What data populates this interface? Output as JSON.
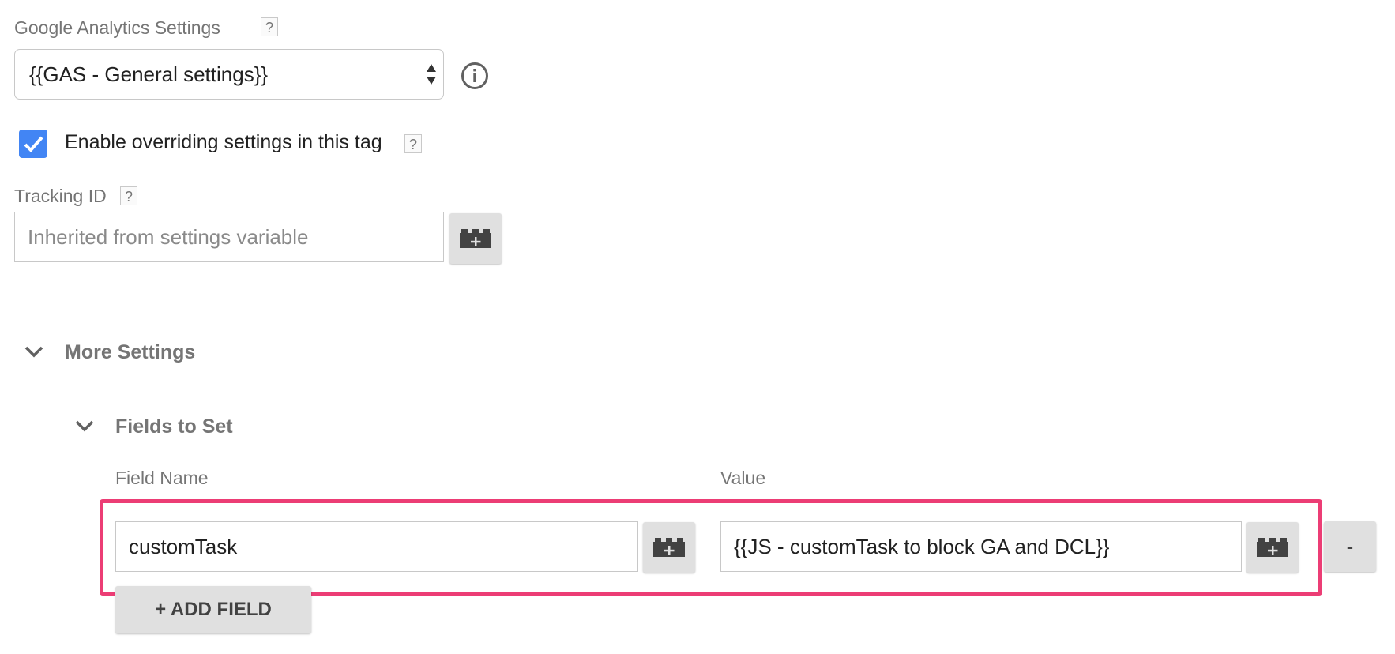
{
  "ga_settings": {
    "label": "Google Analytics Settings",
    "help": "?",
    "selected_value": "{{GAS - General settings}}",
    "info_icon": "info-circle-icon"
  },
  "override": {
    "checked": true,
    "label": "Enable overriding settings in this tag",
    "help": "?"
  },
  "tracking_id": {
    "label": "Tracking ID",
    "help": "?",
    "placeholder": "Inherited from settings variable",
    "variable_icon": "variable-brick-icon"
  },
  "more_settings": {
    "title": "More Settings",
    "icon": "chevron-down-icon"
  },
  "fields_to_set": {
    "title": "Fields to Set",
    "icon": "chevron-down-icon",
    "col_field_name": "Field Name",
    "col_value": "Value",
    "rows": [
      {
        "field_name": "customTask",
        "value": "{{JS - customTask to block GA and DCL}}",
        "remove_label": "-"
      }
    ],
    "add_field_label": "+ ADD FIELD",
    "highlight_color": "#ec3d75"
  },
  "colors": {
    "checkbox": "#4285f4",
    "button_bg": "#e0e0e0",
    "label_text": "#757575"
  }
}
